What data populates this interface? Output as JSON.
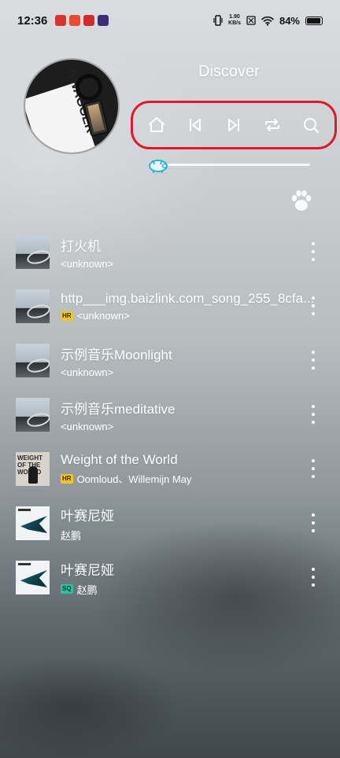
{
  "status": {
    "time": "12:36",
    "speed_value": "1.90",
    "speed_unit": "KB/s",
    "battery": "84%",
    "notif_icons": [
      "app-notification-icon",
      "app-notification-icon",
      "app-notification-icon",
      "app-notification-icon"
    ]
  },
  "header": {
    "title": "Discover"
  },
  "album_art": {
    "text": "SWAGGER"
  },
  "controls": [
    {
      "name": "home",
      "icon": "home-icon"
    },
    {
      "name": "previous",
      "icon": "skip-previous-icon"
    },
    {
      "name": "next",
      "icon": "skip-next-icon"
    },
    {
      "name": "repeat",
      "icon": "repeat-icon"
    },
    {
      "name": "search",
      "icon": "search-icon"
    }
  ],
  "progress": {
    "value": 0.0,
    "thumb_icon": "pig-icon"
  },
  "paw_icon": "paw-icon",
  "songs": [
    {
      "title": "打火机",
      "artist": "<unknown>",
      "badge": "",
      "thumb": "gray"
    },
    {
      "title": "http___img.baizlink.com_song_255_8cfa...",
      "artist": "<unknown>",
      "badge": "HR",
      "thumb": "gray"
    },
    {
      "title": "示例音乐Moonlight",
      "artist": "<unknown>",
      "badge": "",
      "thumb": "gray"
    },
    {
      "title": "示例音乐meditative",
      "artist": "<unknown>",
      "badge": "",
      "thumb": "gray"
    },
    {
      "title": "Weight of the World",
      "artist": "Oomloud、Willemijn May",
      "badge": "HR",
      "thumb": "weight",
      "thumb_text": "WEIGHT OF THE WORLD"
    },
    {
      "title": "叶赛尼娅",
      "artist": "赵鹏",
      "badge": "",
      "thumb": "bird"
    },
    {
      "title": "叶赛尼娅",
      "artist": "赵鹏",
      "badge": "SQ",
      "thumb": "bird"
    }
  ],
  "colors": {
    "highlight_border": "#e01a2a",
    "hr_badge": "#f3c623",
    "sq_badge": "#2fbfa0",
    "progress_thumb": "#29b6d6"
  }
}
